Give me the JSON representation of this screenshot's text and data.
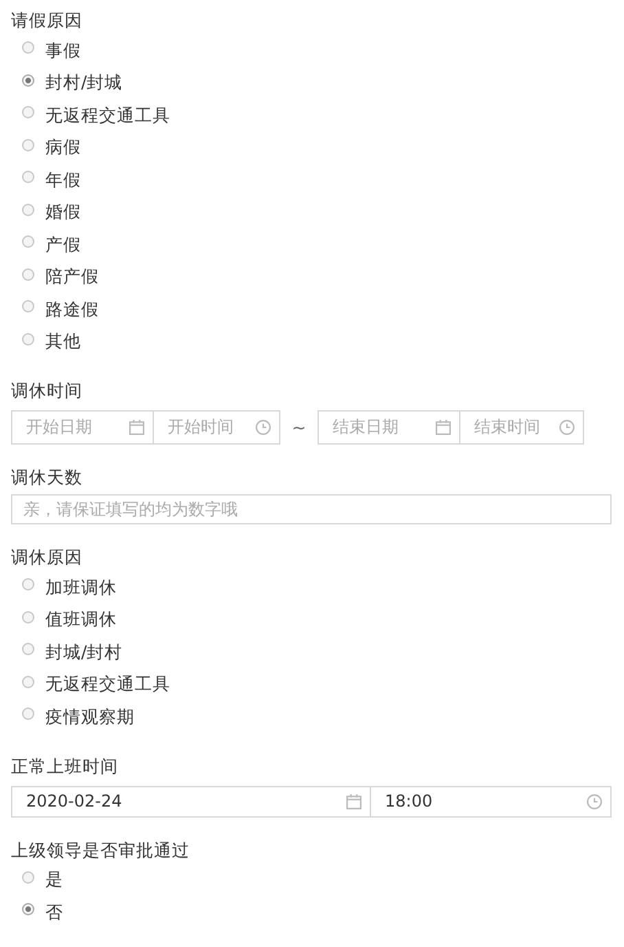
{
  "sections": [
    {
      "kind": "radio",
      "label": "请假原因",
      "options": [
        {
          "label": "事假",
          "selected": false
        },
        {
          "label": "封村/封城",
          "selected": true
        },
        {
          "label": "无返程交通工具",
          "selected": false
        },
        {
          "label": "病假",
          "selected": false
        },
        {
          "label": "年假",
          "selected": false
        },
        {
          "label": "婚假",
          "selected": false
        },
        {
          "label": "产假",
          "selected": false
        },
        {
          "label": "陪产假",
          "selected": false
        },
        {
          "label": "路途假",
          "selected": false
        },
        {
          "label": "其他",
          "selected": false
        }
      ]
    },
    {
      "kind": "range",
      "label": "调休时间",
      "start_date": {
        "placeholder": "开始日期"
      },
      "start_time": {
        "placeholder": "开始时间"
      },
      "separator": "~",
      "end_date": {
        "placeholder": "结束日期"
      },
      "end_time": {
        "placeholder": "结束时间"
      }
    },
    {
      "kind": "input",
      "label": "调休天数",
      "placeholder": "亲，请保证填写的均为数字哦"
    },
    {
      "kind": "radio",
      "label": "调休原因",
      "options": [
        {
          "label": "加班调休",
          "selected": false
        },
        {
          "label": "值班调休",
          "selected": false
        },
        {
          "label": "封城/封村",
          "selected": false
        },
        {
          "label": "无返程交通工具",
          "selected": false
        },
        {
          "label": "疫情观察期",
          "selected": false
        }
      ]
    },
    {
      "kind": "datetime",
      "label": "正常上班时间",
      "date": "2020-02-24",
      "time": "18:00"
    },
    {
      "kind": "radio",
      "label": "上级领导是否审批通过",
      "options": [
        {
          "label": "是",
          "selected": false
        },
        {
          "label": "否",
          "selected": true
        }
      ]
    }
  ]
}
